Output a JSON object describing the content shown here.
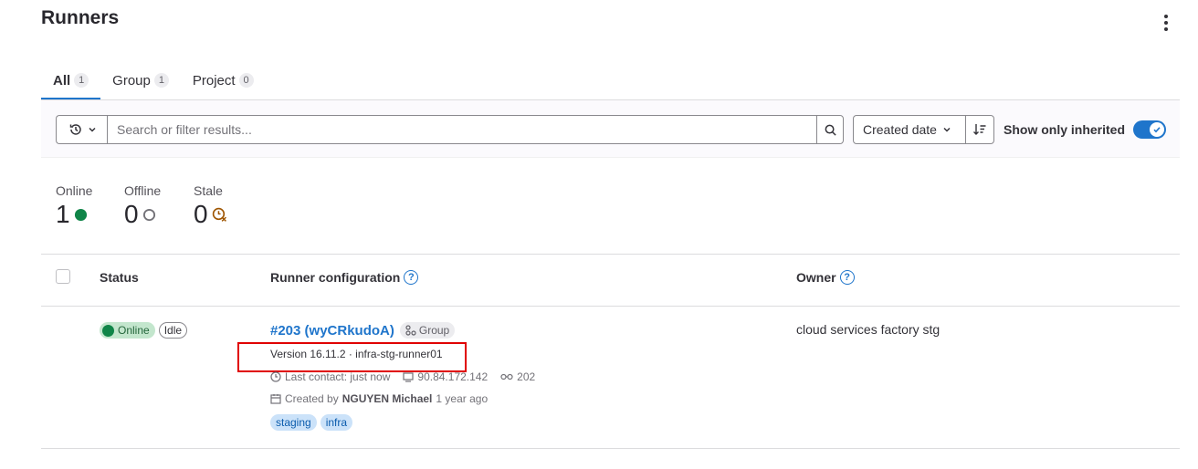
{
  "header": {
    "title": "Runners"
  },
  "tabs": [
    {
      "label": "All",
      "count": "1"
    },
    {
      "label": "Group",
      "count": "1"
    },
    {
      "label": "Project",
      "count": "0"
    }
  ],
  "filter": {
    "search_placeholder": "Search or filter results...",
    "sort_label": "Created date",
    "inherited_label": "Show only inherited",
    "inherited_on": true
  },
  "stats": {
    "online": {
      "label": "Online",
      "value": "1"
    },
    "offline": {
      "label": "Offline",
      "value": "0"
    },
    "stale": {
      "label": "Stale",
      "value": "0"
    }
  },
  "table": {
    "columns": {
      "status": "Status",
      "config": "Runner configuration",
      "owner": "Owner"
    },
    "rows": [
      {
        "status_online": "Online",
        "status_idle": "Idle",
        "runner_id": "#203 (wyCRkudoA)",
        "type": "Group",
        "version_line": "Version 16.11.2 · infra-stg-runner01",
        "last_contact": "Last contact: just now",
        "ip": "90.84.172.142",
        "jobs": "202",
        "created_prefix": "Created by",
        "created_by": "NGUYEN Michael",
        "created_ago": "1 year ago",
        "tags": [
          "staging",
          "infra"
        ],
        "owner": "cloud services factory stg"
      }
    ]
  },
  "colors": {
    "accent": "#1f75cb",
    "online": "#108548",
    "stale": "#9e5400",
    "highlight": "#e00000"
  }
}
